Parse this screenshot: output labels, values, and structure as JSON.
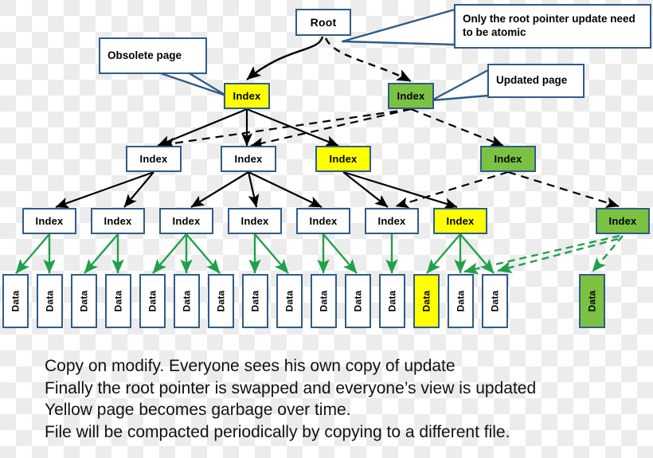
{
  "diagram": {
    "title": "Copy-on-modify B-tree page update diagram",
    "colors": {
      "box_border": "#2e5c8a",
      "obsolete_fill": "#ffff00",
      "updated_fill": "#7cc242",
      "default_fill": "#ffffff",
      "black_edge": "#000000",
      "green_edge": "#21a04a",
      "callout_border": "#2e5c8a"
    },
    "root": {
      "label": "Root"
    },
    "callouts": [
      {
        "id": "obsolete",
        "text": "Obsolete page"
      },
      {
        "id": "atomic",
        "text": "Only the root pointer update need to be atomic"
      },
      {
        "id": "updated",
        "text": "Updated page"
      }
    ],
    "level2": [
      {
        "label": "Index",
        "state": "obsolete"
      },
      {
        "label": "Index",
        "state": "updated"
      }
    ],
    "level3": [
      {
        "label": "Index",
        "state": "normal"
      },
      {
        "label": "Index",
        "state": "normal"
      },
      {
        "label": "Index",
        "state": "obsolete"
      },
      {
        "label": "Index",
        "state": "updated"
      }
    ],
    "level4": [
      {
        "label": "Index",
        "state": "normal"
      },
      {
        "label": "Index",
        "state": "normal"
      },
      {
        "label": "Index",
        "state": "normal"
      },
      {
        "label": "Index",
        "state": "normal"
      },
      {
        "label": "Index",
        "state": "normal"
      },
      {
        "label": "Index",
        "state": "normal"
      },
      {
        "label": "Index",
        "state": "obsolete"
      },
      {
        "label": "Index",
        "state": "updated"
      }
    ],
    "data": [
      {
        "label": "Data",
        "state": "normal"
      },
      {
        "label": "Data",
        "state": "normal"
      },
      {
        "label": "Data",
        "state": "normal"
      },
      {
        "label": "Data",
        "state": "normal"
      },
      {
        "label": "Data",
        "state": "normal"
      },
      {
        "label": "Data",
        "state": "normal"
      },
      {
        "label": "Data",
        "state": "normal"
      },
      {
        "label": "Data",
        "state": "normal"
      },
      {
        "label": "Data",
        "state": "normal"
      },
      {
        "label": "Data",
        "state": "normal"
      },
      {
        "label": "Data",
        "state": "normal"
      },
      {
        "label": "Data",
        "state": "normal"
      },
      {
        "label": "Data",
        "state": "obsolete"
      },
      {
        "label": "Data",
        "state": "normal"
      },
      {
        "label": "Data",
        "state": "normal"
      },
      {
        "label": "Data",
        "state": "updated"
      }
    ],
    "caption": {
      "line1": "Copy on modify.  Everyone sees his own copy of update",
      "line2": "Finally the root pointer is swapped and everyone’s view is updated",
      "line3": "Yellow page becomes garbage over time.",
      "line4": "File will be compacted periodically by copying to a different file."
    }
  }
}
